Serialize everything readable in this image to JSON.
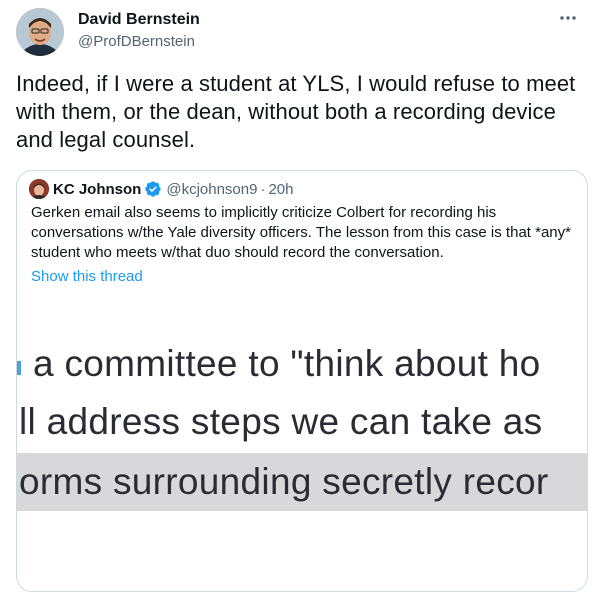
{
  "author": {
    "name": "David Bernstein",
    "handle": "@ProfDBernstein"
  },
  "tweet": {
    "text": "Indeed, if I were a student at YLS, I would refuse to meet with them, or the dean, without both a recording device and legal counsel."
  },
  "more_icon": "more-horizontal-icon",
  "quoted": {
    "name": "KC Johnson",
    "handle": "@kcjohnson9",
    "separator": "·",
    "time": "20h",
    "verified_icon": "verified-badge-icon",
    "text": "Gerken email also seems to implicitly criticize Colbert for recording his conversations w/the Yale diversity officers. The lesson from this case is that *any* student who meets w/that duo should record the conversation.",
    "show_thread": "Show this thread",
    "image_lines": [
      "a committee to \"think about ho",
      "ll address steps we can take as",
      "orms surrounding secretly recor"
    ]
  },
  "colors": {
    "text": "#0f1419",
    "secondary": "#536471",
    "link": "#1d9bf0",
    "border": "#cfd9de",
    "highlight": "#d8d8da"
  }
}
